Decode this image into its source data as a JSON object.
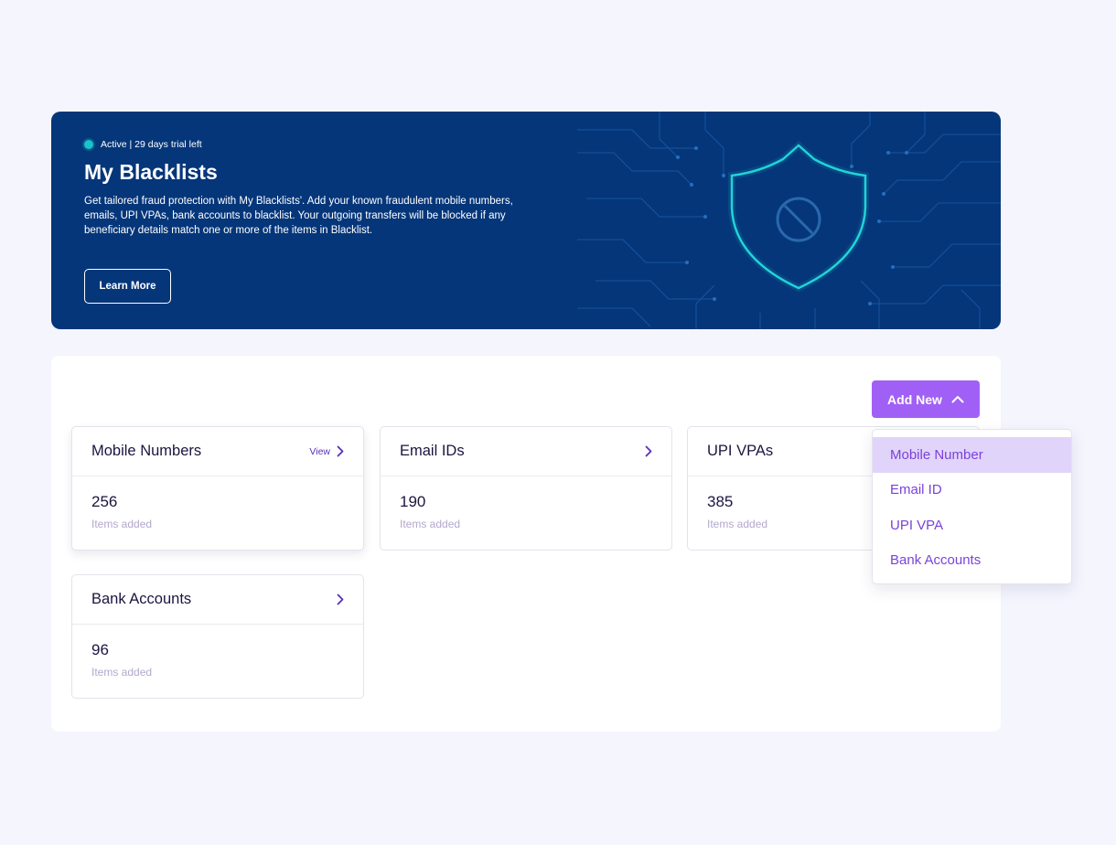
{
  "banner": {
    "status": "Active | 29 days trial left",
    "title": "My Blacklists",
    "description": "Get tailored fraud protection with My Blacklists'. Add your known fraudulent mobile numbers, emails, UPI VPAs, bank accounts to blacklist. Your outgoing transfers will be blocked if any beneficiary details match one or more of the items in Blacklist.",
    "learn_more_label": "Learn More",
    "status_color": "#19c3c7",
    "background": "#05367a",
    "illustration_icon": "shield-block-icon"
  },
  "toolbar": {
    "add_new_label": "Add New",
    "accent": "#a160f5"
  },
  "cards": [
    {
      "title": "Mobile Numbers",
      "link_label": "View",
      "count": "256",
      "sub": "Items added"
    },
    {
      "title": "Email IDs",
      "count": "190",
      "sub": "Items added"
    },
    {
      "title": "UPI VPAs",
      "count": "385",
      "sub": "Items added"
    },
    {
      "title": "Bank Accounts",
      "count": "96",
      "sub": "Items added"
    }
  ],
  "dropdown": {
    "items": [
      "Mobile Number",
      "Email ID",
      "UPI VPA",
      "Bank Accounts"
    ],
    "selected": "Mobile Number"
  }
}
